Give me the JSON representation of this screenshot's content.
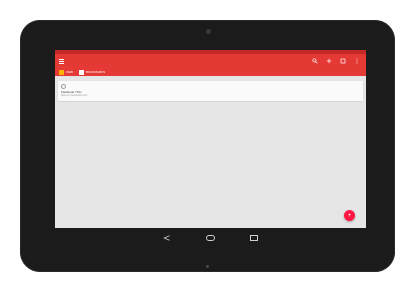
{
  "appbar": {
    "icons": [
      "menu-icon",
      "search-icon",
      "add-icon",
      "tabs-icon",
      "more-vert-icon"
    ]
  },
  "tabs": [
    {
      "label": "WEB",
      "icon": "web-icon"
    },
    {
      "label": "BOOKMARKS",
      "icon": "bookmark-icon"
    }
  ],
  "history": [
    {
      "title": "Facebook YOU",
      "url": "https://m.facebook.com/",
      "icon": "clock-icon"
    }
  ],
  "fab": {
    "label": "+",
    "icon": "add-icon"
  },
  "nav_icons": [
    "back-icon",
    "home-icon",
    "recents-icon"
  ],
  "colors": {
    "primary": "#e53935",
    "status": "#c62828",
    "fab": "#ff1744",
    "bezel": "#1b1b1b"
  }
}
